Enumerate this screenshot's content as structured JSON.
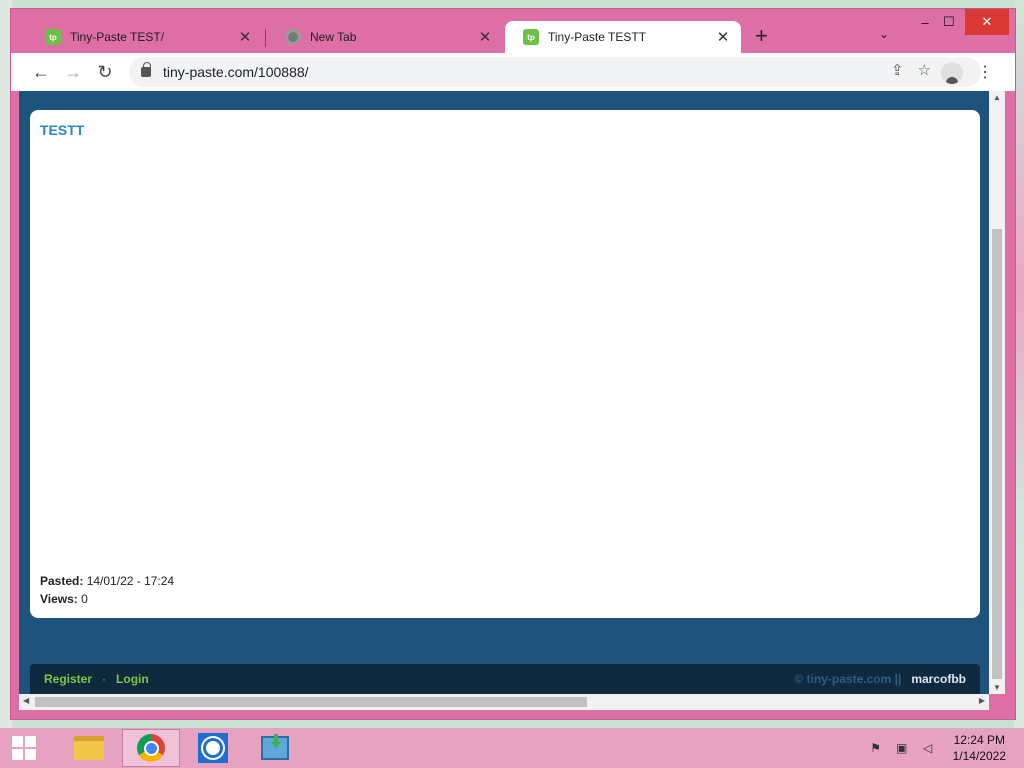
{
  "browser": {
    "tabs": [
      {
        "title": "Tiny-Paste TEST/",
        "favicon": "tp",
        "active": false
      },
      {
        "title": "New Tab",
        "favicon": "chrome",
        "active": false
      },
      {
        "title": "Tiny-Paste TESTT",
        "favicon": "tp",
        "active": true
      }
    ],
    "new_tab_glyph": "+",
    "tab_list_glyph": "⌄",
    "window_controls": {
      "minimize": "–",
      "maximize": "☐",
      "close": "✕"
    },
    "nav": {
      "back": "←",
      "forward": "→",
      "reload": "↻"
    },
    "url": "tiny-paste.com/100888/",
    "omnibox_icons": {
      "share": "⇪",
      "bookmark": "☆"
    },
    "menu_glyph": "⋮"
  },
  "page": {
    "paste_title": "TESTT",
    "pasted_label": "Pasted:",
    "pasted_value": "14/01/22 - 17:24",
    "views_label": "Views:",
    "views_value": "0",
    "footer": {
      "register": "Register",
      "separator": "·",
      "login": "Login",
      "copyright": "© tiny-paste.com ||",
      "username": "marcofbb"
    },
    "colors": {
      "page_bg": "#1d537c",
      "title": "#2a86c4",
      "footer_link": "#7bc843"
    }
  },
  "taskbar": {
    "apps": [
      "file-explorer-icon",
      "chrome-icon",
      "brightness-icon",
      "installer-icon"
    ],
    "tray_icons": [
      "flag-alert-icon",
      "network-icon",
      "volume-muted-icon"
    ],
    "time": "12:24 PM",
    "date": "1/14/2022"
  }
}
